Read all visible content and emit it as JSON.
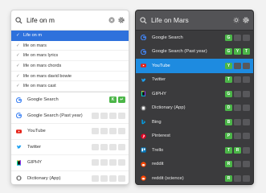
{
  "light_panel": {
    "query": "Life on m",
    "suggestions": [
      {
        "text": "Life on m",
        "selected": true
      },
      {
        "text": "life on mars",
        "selected": false
      },
      {
        "text": "life on mars lyrics",
        "selected": false
      },
      {
        "text": "life on mars chords",
        "selected": false
      },
      {
        "text": "life on mars david bowie",
        "selected": false
      },
      {
        "text": "life on mars cast",
        "selected": false
      }
    ],
    "engines": [
      {
        "name": "Google Search",
        "icon": "G",
        "keys": [
          "K",
          "↵"
        ]
      },
      {
        "name": "Google Search (Past year)",
        "icon": "G",
        "keys": [
          "",
          "",
          "",
          ""
        ]
      },
      {
        "name": "YouTube",
        "icon": "youtube-icon",
        "keys": [
          "",
          "",
          "",
          ""
        ]
      },
      {
        "name": "Twitter",
        "icon": "twitter-icon",
        "keys": [
          "",
          "",
          "",
          ""
        ]
      },
      {
        "name": "GIPHY",
        "icon": "giphy-icon",
        "keys": [
          "",
          "",
          "",
          ""
        ]
      },
      {
        "name": "Dictionary (App)",
        "icon": "dictionary-icon",
        "keys": [
          "",
          "",
          "",
          ""
        ]
      }
    ]
  },
  "dark_panel": {
    "query": "Life on Mars",
    "engines": [
      {
        "name": "Google Search",
        "icon": "G",
        "keys": [
          "G",
          "",
          ""
        ],
        "selected": false
      },
      {
        "name": "Google Search (Past year)",
        "icon": "G",
        "keys": [
          "G",
          "Y",
          "T"
        ],
        "selected": false
      },
      {
        "name": "YouTube",
        "icon": "youtube-icon",
        "keys": [
          "Y",
          "",
          ""
        ],
        "selected": true
      },
      {
        "name": "Twitter",
        "icon": "twitter-icon",
        "keys": [
          "T",
          "",
          ""
        ],
        "selected": false
      },
      {
        "name": "GIPHY",
        "icon": "giphy-icon",
        "keys": [
          "G",
          "",
          ""
        ],
        "selected": false
      },
      {
        "name": "Dictionary (App)",
        "icon": "dictionary-icon",
        "keys": [
          "D",
          "",
          ""
        ],
        "selected": false
      },
      {
        "name": "Bing",
        "icon": "bing-icon",
        "keys": [
          "B",
          "",
          ""
        ],
        "selected": false
      },
      {
        "name": "Pinterest",
        "icon": "pinterest-icon",
        "keys": [
          "P",
          "",
          ""
        ],
        "selected": false
      },
      {
        "name": "Trello",
        "icon": "trello-icon",
        "keys": [
          "T",
          "R",
          ""
        ],
        "selected": false
      },
      {
        "name": "reddit",
        "icon": "reddit-icon",
        "keys": [
          "R",
          "",
          ""
        ],
        "selected": false
      },
      {
        "name": "reddit (science)",
        "icon": "reddit-icon",
        "keys": [
          "R",
          "",
          ""
        ],
        "selected": false
      }
    ]
  },
  "colors": {
    "selection_light": "#2e71dc",
    "selection_dark": "#1e8be0",
    "key_green": "#4bb648",
    "key_blue": "#5cc8f2"
  }
}
